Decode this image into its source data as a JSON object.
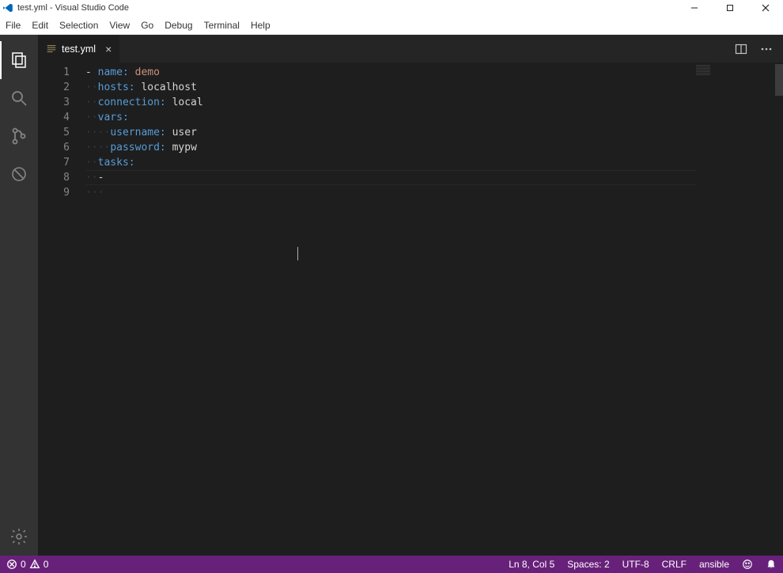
{
  "title": "test.yml - Visual Studio Code",
  "menu": [
    "File",
    "Edit",
    "Selection",
    "View",
    "Go",
    "Debug",
    "Terminal",
    "Help"
  ],
  "tab": {
    "name": "test.yml",
    "close": "×"
  },
  "code": {
    "lines": [
      {
        "ws": "",
        "pre": "- ",
        "key": "name:",
        "sep": " ",
        "val": "demo",
        "valClass": "tok-str"
      },
      {
        "ws": "··",
        "pre": "",
        "key": "hosts:",
        "sep": " ",
        "val": "localhost",
        "valClass": "tok-val"
      },
      {
        "ws": "··",
        "pre": "",
        "key": "connection:",
        "sep": " ",
        "val": "local",
        "valClass": "tok-val"
      },
      {
        "ws": "··",
        "pre": "",
        "key": "vars:",
        "sep": "",
        "val": "",
        "valClass": "tok-val"
      },
      {
        "ws": "····",
        "pre": "",
        "key": "username:",
        "sep": " ",
        "val": "user",
        "valClass": "tok-val"
      },
      {
        "ws": "····",
        "pre": "",
        "key": "password:",
        "sep": " ",
        "val": "mypw",
        "valClass": "tok-val"
      },
      {
        "ws": "··",
        "pre": "",
        "key": "tasks:",
        "sep": "",
        "val": "",
        "valClass": "tok-val"
      },
      {
        "ws": "··",
        "pre": "- ",
        "key": "",
        "sep": "",
        "val": "",
        "valClass": "tok-val"
      },
      {
        "ws": "···",
        "pre": "",
        "key": "",
        "sep": "",
        "val": "",
        "valClass": "tok-val"
      }
    ]
  },
  "status": {
    "errors": "0",
    "warnings": "0",
    "position": "Ln 8, Col 5",
    "spaces": "Spaces: 2",
    "encoding": "UTF-8",
    "eol": "CRLF",
    "lang": "ansible"
  }
}
